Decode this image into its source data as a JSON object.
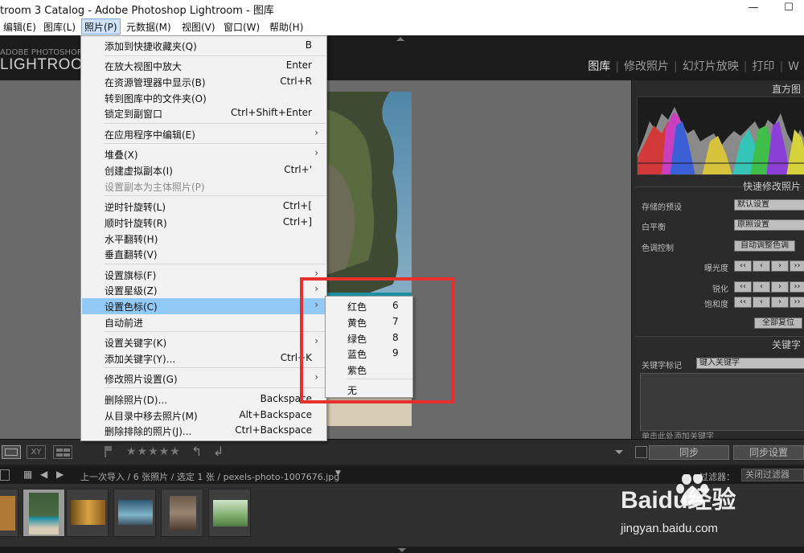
{
  "app": {
    "title": "troom 3 Catalog - Adobe Photoshop Lightroom - 图库",
    "minimize_glyph": "—",
    "maximize_glyph": "☐"
  },
  "menubar": {
    "items": [
      "编辑(E)",
      "图库(L)",
      "照片(P)",
      "元数据(M)",
      "视图(V)",
      "窗口(W)",
      "帮助(H)"
    ],
    "active": "照片(P)"
  },
  "identity": {
    "small": "ADOBE PHOTOSHOP",
    "big": "LIGHTROOM"
  },
  "modules": [
    "图库",
    "修改照片",
    "幻灯片放映",
    "打印",
    "W"
  ],
  "right_panel": {
    "histogram_title": "直方图",
    "quick_develop_title": "快速修改照片",
    "saved_preset_label": "存储的预设",
    "saved_preset_value": "默认设置",
    "white_balance_label": "白平衡",
    "white_balance_value": "原照设置",
    "tone_control_label": "色调控制",
    "auto_tone_button": "自动调整色调",
    "exposure_label": "曝光度",
    "clarity_label": "锐化",
    "saturation_label": "饱和度",
    "reset_all_button": "全部复位",
    "keywording_title": "关键字",
    "keyword_tags_label": "关键字标记",
    "keyword_tags_value": "键入关键字",
    "click_to_add": "单击此处添加关键字",
    "sync_button": "同步",
    "sync_settings_button": "同步设置"
  },
  "filmstrip": {
    "breadcrumb": "上一次导入 / 6 张照片 / 选定 1 张 / pexels-photo-1007676.jpg",
    "filter_label": "过滤器：",
    "filter_value": "关闭过滤器"
  },
  "toolbar": {
    "stars": "★★★★★"
  },
  "photo_menu": {
    "items": [
      {
        "label": "添加到快捷收藏夹(Q)",
        "shortcut": "B"
      },
      {
        "label": "在放大视图中放大",
        "shortcut": "Enter"
      },
      {
        "label": "在资源管理器中显示(B)",
        "shortcut": "Ctrl+R"
      },
      {
        "label": "转到图库中的文件夹(O)",
        "shortcut": ""
      },
      {
        "label": "锁定到副窗口",
        "shortcut": "Ctrl+Shift+Enter"
      },
      {
        "label": "在应用程序中编辑(E)",
        "shortcut": ""
      },
      {
        "label": "堆叠(X)",
        "shortcut": ""
      },
      {
        "label": "创建虚拟副本(I)",
        "shortcut": "Ctrl+'"
      },
      {
        "label": "设置副本为主体照片(P)",
        "shortcut": ""
      },
      {
        "label": "逆时针旋转(L)",
        "shortcut": "Ctrl+["
      },
      {
        "label": "顺时针旋转(R)",
        "shortcut": "Ctrl+]"
      },
      {
        "label": "水平翻转(H)",
        "shortcut": ""
      },
      {
        "label": "垂直翻转(V)",
        "shortcut": ""
      },
      {
        "label": "设置旗标(F)",
        "shortcut": ""
      },
      {
        "label": "设置星级(Z)",
        "shortcut": ""
      },
      {
        "label": "设置色标(C)",
        "shortcut": ""
      },
      {
        "label": "自动前进",
        "shortcut": ""
      },
      {
        "label": "设置关键字(K)",
        "shortcut": ""
      },
      {
        "label": "添加关键字(Y)...",
        "shortcut": "Ctrl+K"
      },
      {
        "label": "修改照片设置(G)",
        "shortcut": ""
      },
      {
        "label": "删除照片(D)...",
        "shortcut": "Backspace"
      },
      {
        "label": "从目录中移去照片(M)",
        "shortcut": "Alt+Backspace"
      },
      {
        "label": "删除排除的照片(J)...",
        "shortcut": "Ctrl+Backspace"
      }
    ],
    "submenu_arrow": "›"
  },
  "color_label_submenu": {
    "items": [
      {
        "label": "红色",
        "shortcut": "6"
      },
      {
        "label": "黄色",
        "shortcut": "7"
      },
      {
        "label": "绿色",
        "shortcut": "8"
      },
      {
        "label": "蓝色",
        "shortcut": "9"
      },
      {
        "label": "紫色",
        "shortcut": ""
      },
      {
        "label": "无",
        "shortcut": ""
      }
    ]
  },
  "watermark": {
    "brand_text": "Baidu经验",
    "url": "jingyan.baidu.com"
  },
  "colors": {
    "highlight": "#91c9f7",
    "annotation_red": "#e7312f",
    "panel_bg": "#2a2a2a",
    "loupe_bg": "#6a6a6a"
  }
}
